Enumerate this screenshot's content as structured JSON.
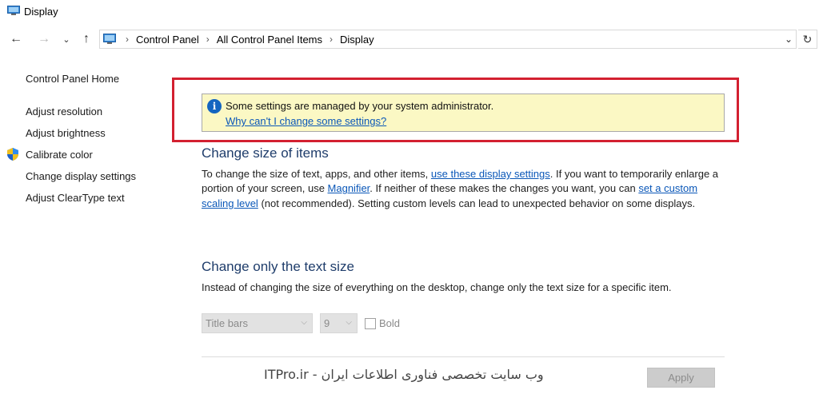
{
  "window": {
    "title": "Display"
  },
  "address_bar": {
    "breadcrumbs": [
      "Control Panel",
      "All Control Panel Items",
      "Display"
    ],
    "separator": "›"
  },
  "sidebar": {
    "home_label": "Control Panel Home",
    "items": [
      {
        "label": "Adjust resolution"
      },
      {
        "label": "Adjust brightness"
      },
      {
        "label": "Calibrate color",
        "icon": "uac-shield-icon"
      },
      {
        "label": "Change display settings"
      },
      {
        "label": "Adjust ClearType text"
      }
    ]
  },
  "infobar": {
    "message": "Some settings are managed by your system administrator.",
    "link": "Why can't I change some settings?"
  },
  "size_section": {
    "title": "Change size of items",
    "text_1": "To change the size of text, apps, and other items, ",
    "link_1": "use these display settings",
    "text_2": ".  If you want to temporarily enlarge a portion of your screen, use ",
    "link_2": "Magnifier",
    "text_3": ".  If neither of these makes the changes you want, you can ",
    "link_3": "set a custom scaling level",
    "text_4": " (not recommended).  Setting custom levels can lead to unexpected behavior on some displays."
  },
  "text_section": {
    "title": "Change only the text size",
    "description": "Instead of changing the size of everything on the desktop, change only the text size for a specific item.",
    "item_select_value": "Title bars",
    "size_select_value": "9",
    "bold_label": "Bold",
    "bold_checked": false
  },
  "apply_label": "Apply",
  "watermark": "ITPro.ir - وب سایت تخصصی فناوری اطلاعات ایران",
  "colors": {
    "accent_link": "#0a57b8",
    "heading": "#1f3d6b",
    "infobar_bg": "#fbf8c4",
    "highlight_frame": "#d32030"
  }
}
